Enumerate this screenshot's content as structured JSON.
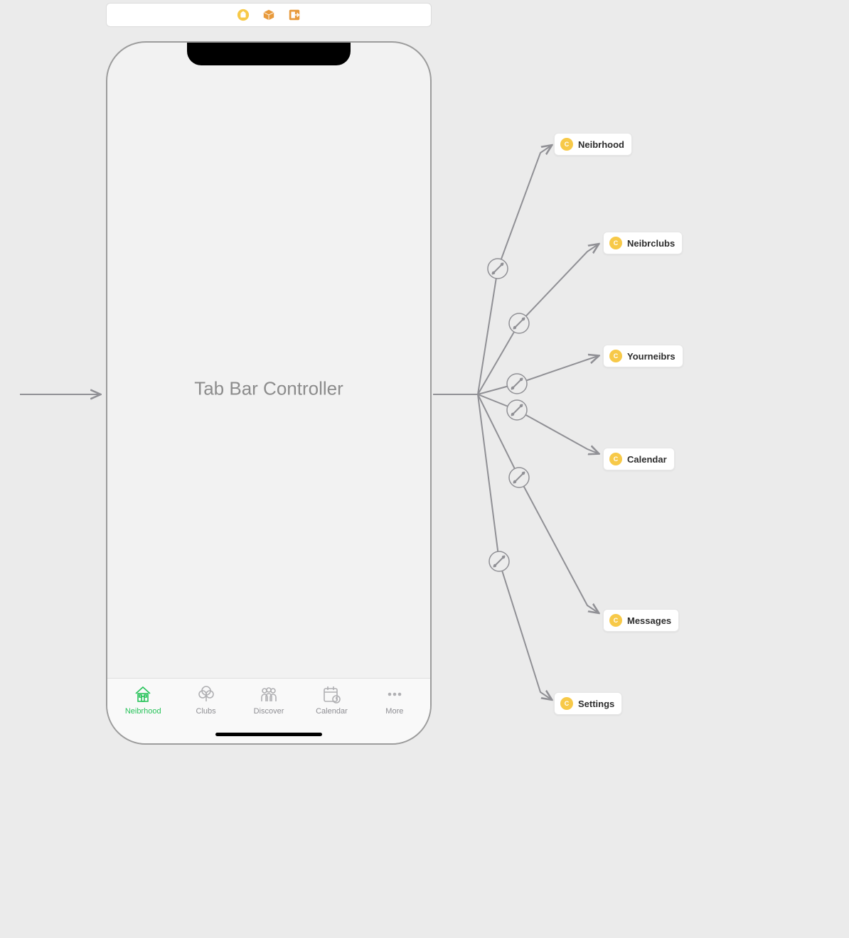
{
  "toolbar": {
    "icons": [
      "storyboard-icon",
      "cube-icon",
      "exit-icon"
    ]
  },
  "phone": {
    "title": "Tab Bar Controller",
    "tabs": [
      {
        "label": "Neibrhood",
        "icon": "house-icon",
        "active": true
      },
      {
        "label": "Clubs",
        "icon": "clubs-icon",
        "active": false
      },
      {
        "label": "Discover",
        "icon": "people-icon",
        "active": false
      },
      {
        "label": "Calendar",
        "icon": "calendar-icon",
        "active": false
      },
      {
        "label": "More",
        "icon": "more-icon",
        "active": false
      }
    ]
  },
  "destinations": [
    {
      "label": "Neibrhood"
    },
    {
      "label": "Neibrclubs"
    },
    {
      "label": "Yourneibrs"
    },
    {
      "label": "Calendar"
    },
    {
      "label": "Messages"
    },
    {
      "label": "Settings"
    }
  ]
}
